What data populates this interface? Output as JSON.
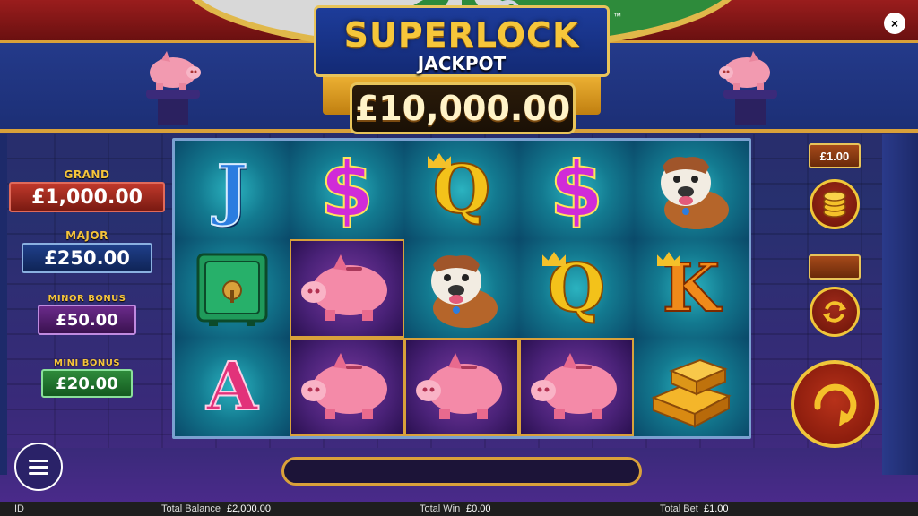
{
  "header": {
    "logo_title": "SUPERLOCK",
    "logo_subtitle": "JACKPOT",
    "trademark": "™",
    "jackpot_value": "£10,000.00",
    "close_label": "×"
  },
  "tiers": [
    {
      "label": "GRAND",
      "value": "£1,000.00",
      "color": "#c0392b"
    },
    {
      "label": "MAJOR",
      "value": "£250.00",
      "color": "#1f4fa0"
    },
    {
      "label": "MINOR BONUS",
      "value": "£50.00",
      "color": "#7a2a9a"
    },
    {
      "label": "MINI BONUS",
      "value": "£20.00",
      "color": "#2e8b3b"
    }
  ],
  "reels": [
    [
      "J",
      "safe-icon",
      "A"
    ],
    [
      "$",
      "piggy-bank-icon",
      "piggy-bank-icon"
    ],
    [
      "Q",
      "bulldog-icon",
      "piggy-bank-icon"
    ],
    [
      "$",
      "Q",
      "piggy-bank-icon"
    ],
    [
      "bulldog-icon",
      "K",
      "gold-bars-icon"
    ]
  ],
  "controls": {
    "bet_value": "£1.00",
    "coins_icon": "coins-icon",
    "autoplay_icon": "autoplay-icon",
    "spin_icon": "spin-icon",
    "menu_icon": "hamburger-icon"
  },
  "footer": {
    "id_label": "ID",
    "balance_label": "Total Balance",
    "balance_value": "£2,000.00",
    "win_label": "Total Win",
    "win_value": "£0.00",
    "bet_label": "Total Bet",
    "bet_value": "£1.00"
  }
}
